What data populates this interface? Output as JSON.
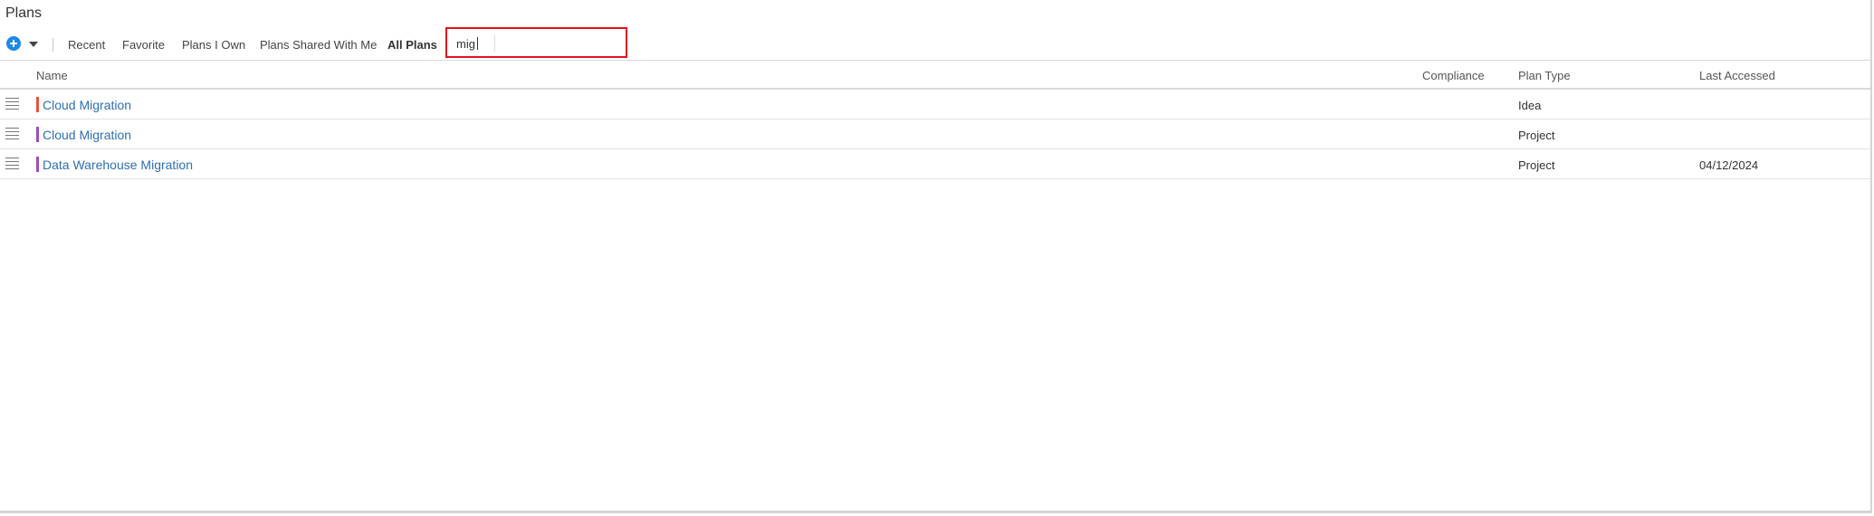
{
  "page": {
    "title": "Plans"
  },
  "toolbar": {
    "add_icon": "plus-circle-icon",
    "dropdown_icon": "caret-down-icon",
    "filters": [
      {
        "label": "Recent",
        "active": false
      },
      {
        "label": "Favorite",
        "active": false
      },
      {
        "label": "Plans I Own",
        "active": false
      },
      {
        "label": "Plans Shared With Me",
        "active": false
      },
      {
        "label": "All Plans",
        "active": true
      }
    ],
    "search": {
      "value": "mig",
      "placeholder": ""
    }
  },
  "table": {
    "columns": {
      "name": "Name",
      "compliance": "Compliance",
      "plan_type": "Plan Type",
      "last_accessed": "Last Accessed"
    },
    "rows": [
      {
        "name": "Cloud Migration",
        "compliance": "",
        "plan_type": "Idea",
        "last_accessed": "",
        "color": "#e8513a"
      },
      {
        "name": "Cloud Migration",
        "compliance": "",
        "plan_type": "Project",
        "last_accessed": "",
        "color": "#9b4fb8"
      },
      {
        "name": "Data Warehouse Migration",
        "compliance": "",
        "plan_type": "Project",
        "last_accessed": "04/12/2024",
        "color": "#9b4fb8"
      }
    ]
  },
  "colors": {
    "accent": "#1e88e5",
    "link": "#2e6fb3",
    "highlight_border": "#e3101e"
  }
}
